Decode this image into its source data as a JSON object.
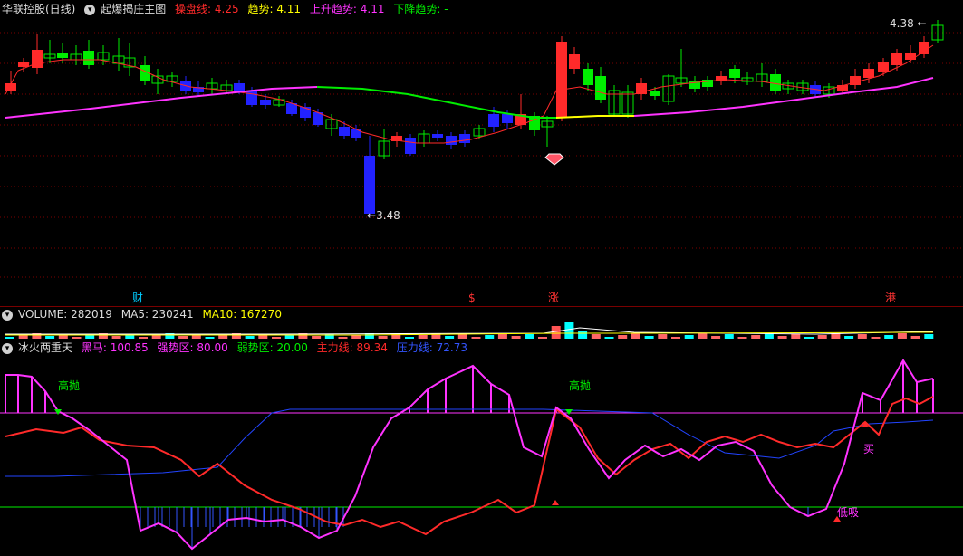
{
  "main": {
    "stock_name": "华联控股(日线)",
    "indicator": "起爆揭庄主图",
    "items": [
      {
        "label": "操盘线:",
        "value": "4.25",
        "color": "#ff2a2a"
      },
      {
        "label": "趋势:",
        "value": "4.11",
        "color": "#ffff00"
      },
      {
        "label": "上升趋势:",
        "value": "4.11",
        "color": "#ff33ff"
      },
      {
        "label": "下降趋势:",
        "value": "-",
        "color": "#00ee00"
      }
    ],
    "high_label": "4.38",
    "low_label": "3.48",
    "markers": [
      {
        "text": "财",
        "color": "#00ccff"
      },
      {
        "text": "$",
        "color": "#ff3333"
      },
      {
        "text": "涨",
        "color": "#ff3333"
      },
      {
        "text": "港",
        "color": "#ff3333"
      }
    ]
  },
  "volume": {
    "label": "VOLUME: 282019",
    "ma5": "MA5: 230241",
    "ma10": "MA10: 167270"
  },
  "osc": {
    "name": "冰火两重天",
    "items": [
      {
        "label": "黑马:",
        "value": "100.85",
        "color": "#ff33ff"
      },
      {
        "label": "强势区:",
        "value": "80.00",
        "color": "#ff33ff"
      },
      {
        "label": "弱势区:",
        "value": "20.00",
        "color": "#00ee00"
      },
      {
        "label": "主力线:",
        "value": "89.34",
        "color": "#ff2a2a"
      },
      {
        "label": "压力线:",
        "value": "72.73",
        "color": "#3355ff"
      }
    ],
    "labels": {
      "sell1": "高抛",
      "sell2": "高抛",
      "buy": "买",
      "low": "低吸"
    }
  },
  "colors": {
    "up": "#ff2a2a",
    "down": "#00ee00",
    "blue": "#2222ff",
    "magenta": "#ff33ff",
    "grid": "#7a0000"
  }
}
